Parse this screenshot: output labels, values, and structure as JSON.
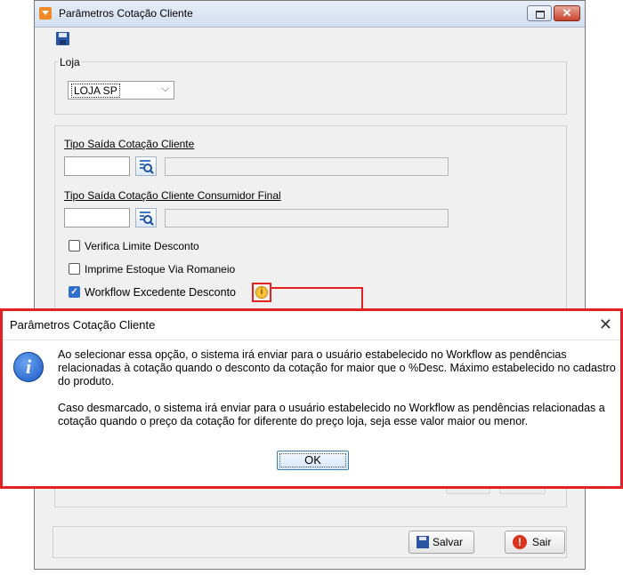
{
  "window": {
    "title": "Parâmetros Cotação Cliente"
  },
  "loja": {
    "legend": "Loja",
    "selected": "LOJA SP"
  },
  "tipo_saida": {
    "label": "Tipo Saída Cotação Cliente",
    "code": "",
    "description": ""
  },
  "tipo_saida_cf": {
    "label": "Tipo Saída Cotação Cliente Consumidor Final",
    "code": "",
    "description": ""
  },
  "checkboxes": [
    {
      "label": "Verifica Limite Desconto",
      "checked": false
    },
    {
      "label": "Imprime Estoque Via Romaneio",
      "checked": false
    },
    {
      "label": "Workflow Excedente Desconto",
      "checked": true
    }
  ],
  "footer": {
    "save_label": "Salvar",
    "exit_label": "Sair"
  },
  "dialog": {
    "title": "Parâmetros Cotação Cliente",
    "paragraph1": "Ao selecionar essa opção, o sistema irá enviar para o usuário estabelecido no Workflow as pendências relacionadas à cotação quando o desconto da cotação for maior que o %Desc. Máximo estabelecido no cadastro do produto.",
    "paragraph2": "Caso desmarcado, o sistema irá enviar para o usuário estabelecido no Workflow as pendências relacionadas a cotação quando o preço da cotação for diferente do preço loja, seja esse valor maior ou menor.",
    "ok_label": "OK"
  },
  "colors": {
    "highlight": "#e22222",
    "accent": "#2f6ecc"
  }
}
